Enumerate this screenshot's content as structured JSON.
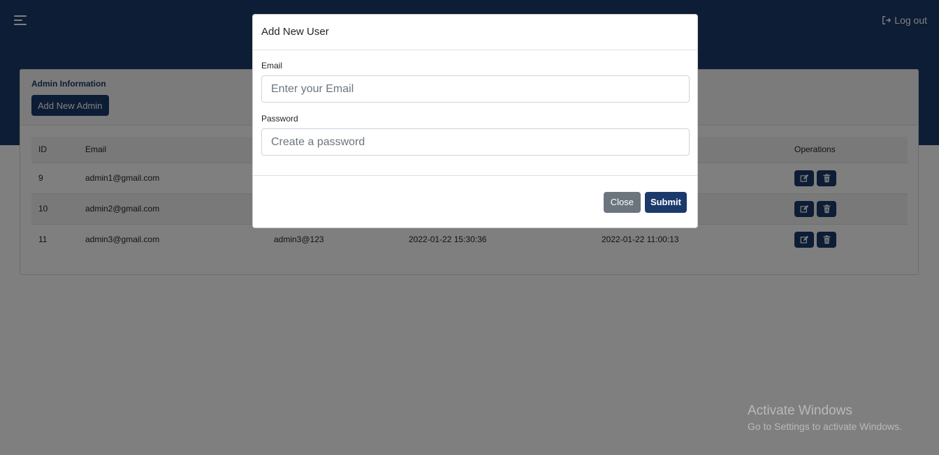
{
  "header": {
    "logout_label": "Log out"
  },
  "card": {
    "title": "Admin Information",
    "add_button_label": "Add New Admin"
  },
  "table": {
    "columns": [
      "ID",
      "Email",
      "",
      "",
      "",
      "Operations"
    ],
    "rows": [
      {
        "id": "9",
        "email": "admin1@gmail.com",
        "password": "",
        "created": "",
        "updated": ""
      },
      {
        "id": "10",
        "email": "admin2@gmail.com",
        "password": "",
        "created": "",
        "updated": ""
      },
      {
        "id": "11",
        "email": "admin3@gmail.com",
        "password": "admin3@123",
        "created": "2022-01-22 15:30:36",
        "updated": "2022-01-22 11:00:13"
      }
    ]
  },
  "modal": {
    "title": "Add New User",
    "email_label": "Email",
    "email_placeholder": "Enter your Email",
    "email_value": "",
    "password_label": "Password",
    "password_placeholder": "Create a password",
    "password_value": "",
    "close_label": "Close",
    "submit_label": "Submit"
  },
  "watermark": {
    "title": "Activate Windows",
    "subtitle": "Go to Settings to activate Windows."
  },
  "colors": {
    "primary": "#1b3a6b",
    "secondary": "#6c757d",
    "overlay": "rgba(0,0,0,0.5)"
  },
  "icons": {
    "menu": "hamburger-icon",
    "logout": "logout-icon",
    "edit": "edit-icon",
    "delete": "trash-icon"
  }
}
